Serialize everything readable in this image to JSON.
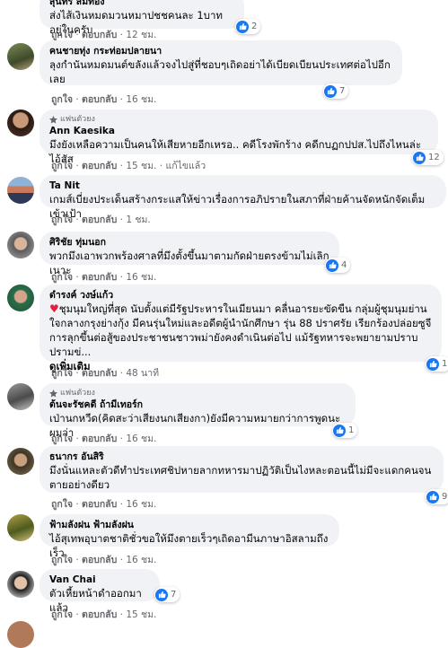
{
  "action_labels": {
    "like": "ถูกใจ",
    "reply": "ตอบกลับ",
    "edited": "แก้ไขแล้ว",
    "sep": "·"
  },
  "colors": {
    "bubble": "#f0f2f5",
    "like_blue": "#1877f2",
    "meta_gray": "#65676b"
  },
  "comments": [
    {
      "author": "สุนทร สมทอง",
      "text": "ส่งไส้เงินหมดมวนหมาปชชคนละ 1บาทอยู่ในครับ",
      "time": "12 ชม.",
      "likes": "2"
    },
    {
      "author": "คนชายทุ่ง กระท่อมปลายนา",
      "text": "ลุงกำนันหมดมนต์ขลังแล้วจงไปสู่ที่ชอบๆเถิดอย่าได้เบียดเบียนประเทศต่อไปอีกเลย",
      "time": "16 ชม.",
      "likes": "7"
    },
    {
      "fan_badge": "แฟนตัวยง",
      "author": "Ann Kaesika",
      "text": "มึงยังเหลือความเป็นคนให้เสียหายอีกเหรอ.. คดีโรงพักร้าง คดีกบฏกปปส.ไปถึงไหนล่ะไอ้สัส",
      "time": "15 ชม.",
      "edited": true,
      "likes": "12"
    },
    {
      "author": "Ta Nit",
      "text": "เกมส์เบี่ยงประเด็นสร้างกระแสให้ข่าวเรื่องการอภิปรายในสภาที่ฝ่ายค้านจัดหนักจัดเต็มเข้าเป้า",
      "time": "1 ชม."
    },
    {
      "author": "ศิริชัย ทุ่มนอก",
      "text": "พวกมึงเอาพวกพร้องศาลที่มึงตั้งขึ้นมาตามกัดฝ่ายตรงข้ามไม่เลิกเนาะ",
      "time": "16 ชม.",
      "likes": "4"
    },
    {
      "author": "ดำรงค์ วงษ์แก้ว",
      "text": "ชุมนุมใหญ่ที่สุด นับตั้งแต่มีรัฐประหารในเมียนมา คลื่นอารยะขัดขืน กลุ่มผู้ชุมนุมย่านใจกลางกรุงย่างกุ้ง มีคนรุ่นใหม่และอดีตผู้นำนักศึกษา รุ่น 88 ปราศรัย เรียกร้องปล่อยซูจี\nการลุกขึ้นต่อสู้ของประชาชนชาวพม่ายังคงดำเนินต่อไป แม้รัฐทหารจะพยายามปราบปรามข่...",
      "see_more": "ดูเพิ่มเติม",
      "time": "48 นาที",
      "likes": "1"
    },
    {
      "fan_badge": "แฟนตัวยง",
      "author": "ต้นจะรัชคดี ถ้ามีเทอร์ก",
      "text": "เป่านกหวีด(คิดสะว่าเสียงนกเสียงกา)ยังมีความหมายกว่าการพูดนะผมว่า",
      "time": "16 ชม.",
      "likes": "1"
    },
    {
      "author": "ธนากร อันสิริ",
      "text": "มึงนั่นแหละตัวดีทำประเทศชิปหายลากทหารมาปฏิวัติเป็นไงหละตอนนี้ไม่มีจะแดกคนจนตายอย่างดียว",
      "time": "16 ชม.",
      "likes": "9"
    },
    {
      "author": "ฟ้ามลังฝน ฟ้ามลังฝน",
      "text": "ไอ้สุเทพอุบาตชาติชั่วขอให้มึงตายเร็วๆเถิดอามีนภาษาอิสลามถึงเร็ว",
      "time": "16 ชม."
    },
    {
      "author": "Van Chai",
      "text": "ตัวเหี้ยหน้าดำออกมาแล้ว",
      "time": "15 ชม.",
      "likes": "7"
    }
  ]
}
